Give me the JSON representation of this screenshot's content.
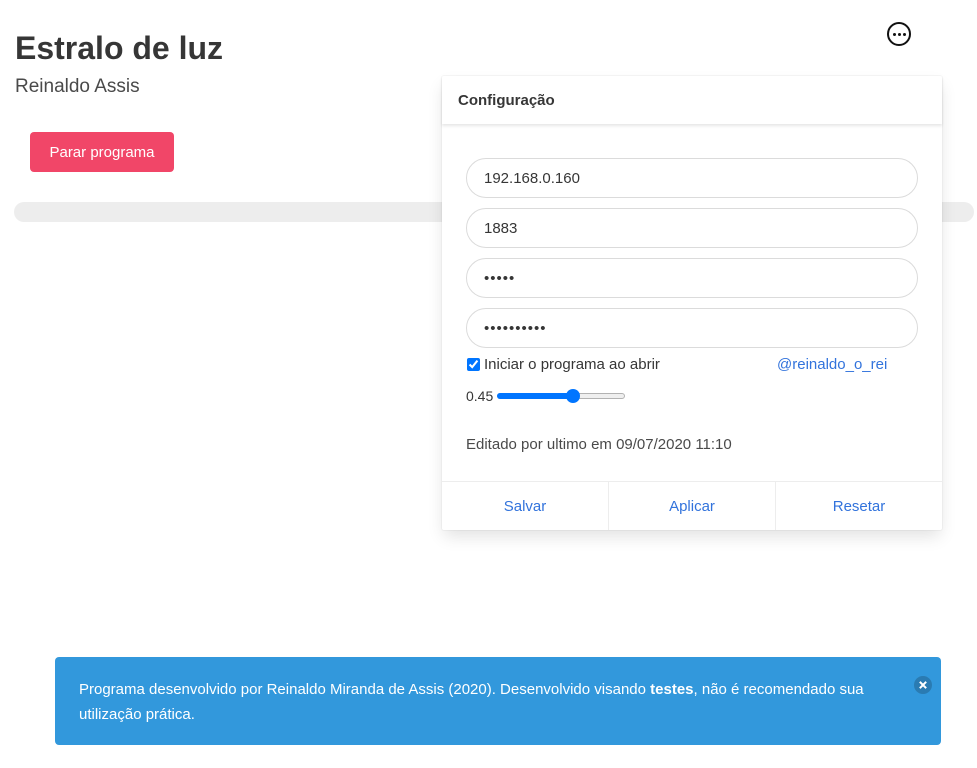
{
  "header": {
    "title": "Estralo de luz",
    "subtitle": "Reinaldo Assis"
  },
  "actions": {
    "stop_label": "Parar programa",
    "more_icon": "more-horizontal-circle-icon"
  },
  "progress": {
    "value_percent": 0
  },
  "config": {
    "title": "Configuração",
    "fields": {
      "host": "192.168.0.160",
      "port": "1883",
      "user": "•••••",
      "password": "••••••••••"
    },
    "autostart_label": "Iniciar o programa ao abrir",
    "autostart_checked": true,
    "handle": "@reinaldo_o_rei",
    "slider_value": "0.45",
    "slider_fraction": 0.6,
    "edited_text": "Editado por ultimo em 09/07/2020 11:10",
    "footer": {
      "save": "Salvar",
      "apply": "Aplicar",
      "reset": "Resetar"
    }
  },
  "notification": {
    "text_before": "Programa desenvolvido por Reinaldo Miranda de Assis (2020). Desenvolvido visando ",
    "text_bold": "testes",
    "text_after": ", não é recomendado sua utilização prática.",
    "close_icon": "close-icon"
  },
  "colors": {
    "danger": "#f14668",
    "info": "#3298dc",
    "link": "#3273dc",
    "slider_accent": "#0075ff"
  }
}
